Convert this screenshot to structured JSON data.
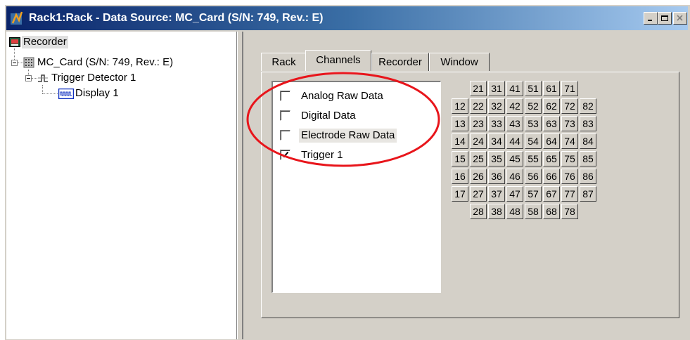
{
  "window": {
    "title": "Rack1:Rack - Data Source: MC_Card (S/N: 749, Rev.: E)",
    "title_bar_colors": [
      "#0a246a",
      "#a6caf0"
    ]
  },
  "tree": [
    {
      "label": "Recorder",
      "icon": "recorder-icon",
      "selected": true
    },
    {
      "label": "MC_Card (S/N: 749, Rev.: E)",
      "icon": "card-icon"
    },
    {
      "label": "Trigger Detector 1",
      "icon": "trigger-detector-icon"
    },
    {
      "label": "Display 1",
      "icon": "display-icon"
    }
  ],
  "tabs": [
    {
      "label": "Rack"
    },
    {
      "label": "Channels",
      "active": true
    },
    {
      "label": "Recorder"
    },
    {
      "label": "Window"
    }
  ],
  "streams": [
    {
      "label": "Analog Raw Data",
      "checked": false
    },
    {
      "label": "Digital Data",
      "checked": false
    },
    {
      "label": "Electrode Raw Data",
      "checked": false,
      "highlighted": true
    },
    {
      "label": "Trigger 1",
      "checked": true
    }
  ],
  "channels": {
    "row1": [
      "21",
      "31",
      "41",
      "51",
      "61",
      "71"
    ],
    "row2": [
      "12",
      "22",
      "32",
      "42",
      "52",
      "62",
      "72",
      "82"
    ],
    "row3": [
      "13",
      "23",
      "33",
      "43",
      "53",
      "63",
      "73",
      "83"
    ],
    "row4": [
      "14",
      "24",
      "34",
      "44",
      "54",
      "64",
      "74",
      "84"
    ],
    "row5": [
      "15",
      "25",
      "35",
      "45",
      "55",
      "65",
      "75",
      "85"
    ],
    "row6": [
      "16",
      "26",
      "36",
      "46",
      "56",
      "66",
      "76",
      "86"
    ],
    "row7": [
      "17",
      "27",
      "37",
      "47",
      "57",
      "67",
      "77",
      "87"
    ],
    "row8": [
      "28",
      "38",
      "48",
      "58",
      "68",
      "78"
    ]
  },
  "annotation": {
    "shape": "ellipse",
    "color": "#e8151b"
  }
}
